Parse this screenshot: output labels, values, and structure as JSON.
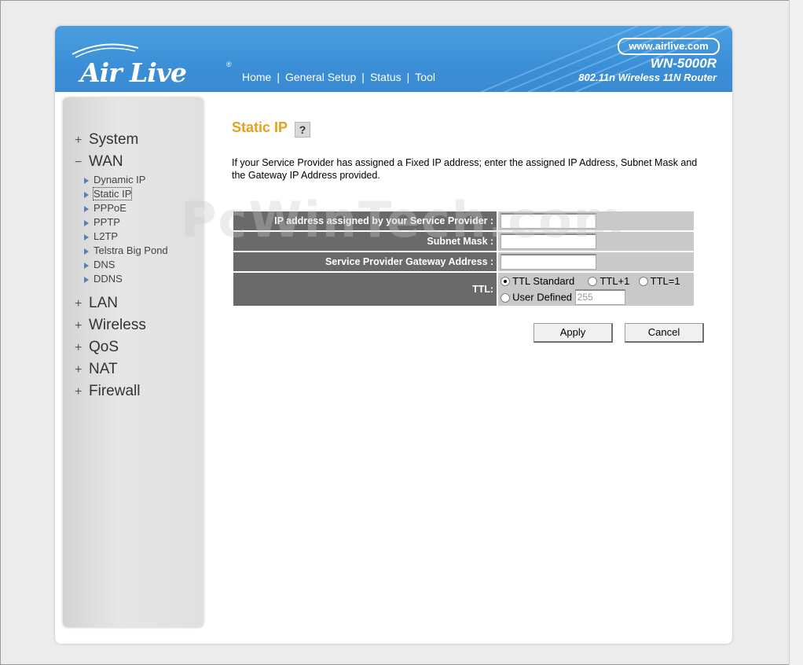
{
  "header": {
    "logo_text": "Air Live",
    "logo_reg": "®",
    "nav": [
      "Home",
      "General Setup",
      "Status",
      "Tool"
    ],
    "url": "www.airlive.com",
    "model": "WN-5000R",
    "model_sub": "802.11n Wireless 11N Router"
  },
  "sidebar": {
    "system": {
      "sign": "+",
      "label": "System"
    },
    "wan": {
      "sign": "−",
      "label": "WAN"
    },
    "wan_items": [
      "Dynamic IP",
      "Static IP",
      "PPPoE",
      "PPTP",
      "L2TP",
      "Telstra Big Pond",
      "DNS",
      "DDNS"
    ],
    "selected_item": "Static IP",
    "lan": {
      "sign": "+",
      "label": "LAN"
    },
    "wireless": {
      "sign": "+",
      "label": "Wireless"
    },
    "qos": {
      "sign": "+",
      "label": "QoS"
    },
    "nat": {
      "sign": "+",
      "label": "NAT"
    },
    "firewall": {
      "sign": "+",
      "label": "Firewall"
    }
  },
  "main": {
    "title": "Static IP",
    "help_icon": "?",
    "description": "If your Service Provider has assigned a Fixed IP address; enter the assigned IP Address, Subnet Mask and the Gateway IP Address provided.",
    "fields": {
      "ip_label": "IP address assigned by your Service Provider :",
      "ip_value": "",
      "mask_label": "Subnet Mask :",
      "mask_value": "",
      "gateway_label": "Service Provider Gateway Address :",
      "gateway_value": "",
      "ttl_label": "TTL:",
      "ttl_standard": "TTL Standard",
      "ttl_plus1": "TTL+1",
      "ttl_eq1": "TTL=1",
      "ttl_user": "User Defined",
      "ttl_user_value": "255",
      "ttl_selected": "TTL Standard"
    },
    "apply_label": "Apply",
    "cancel_label": "Cancel"
  },
  "watermark": "PcWinTech.com",
  "colors": {
    "header_blue": "#3b8fd6",
    "title_orange": "#e8a21a",
    "label_bg": "#6a6a6a",
    "value_bg": "#c9c9c9"
  }
}
